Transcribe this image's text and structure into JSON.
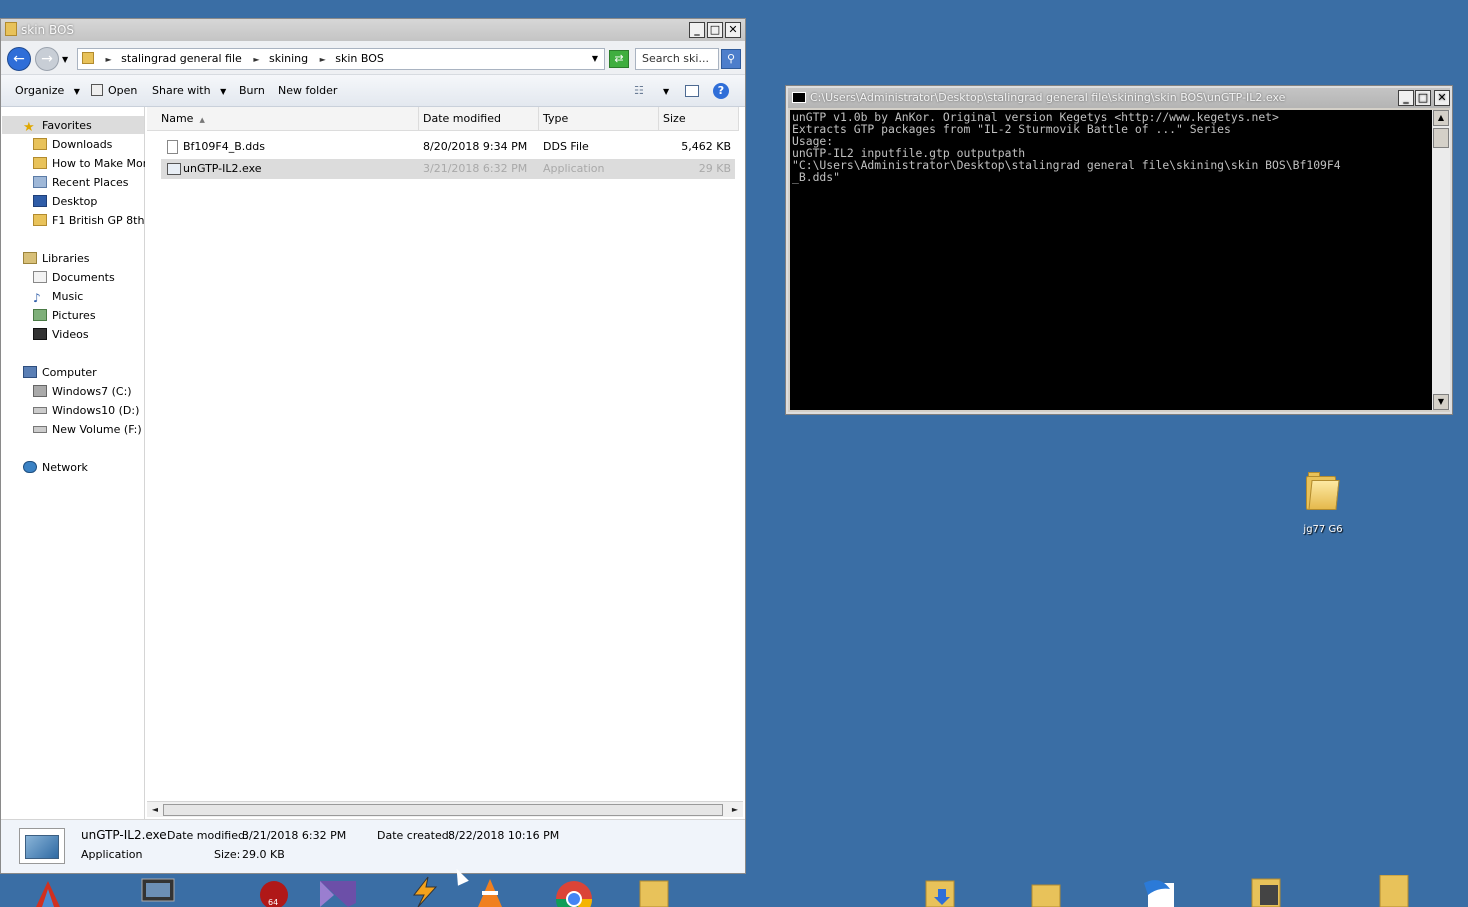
{
  "explorer": {
    "title": "skin BOS",
    "breadcrumb": [
      "stalingrad general file",
      "skining",
      "skin BOS"
    ],
    "search_placeholder": "Search ski...",
    "toolbar": {
      "organize": "Organize",
      "open": "Open",
      "share_with": "Share with",
      "burn": "Burn",
      "new_folder": "New folder"
    },
    "nav": {
      "favorites": "Favorites",
      "favorites_items": [
        "Downloads",
        "How to Make Mone",
        "Recent Places",
        "Desktop",
        "F1 British GP 8th Ju"
      ],
      "libraries": "Libraries",
      "libraries_items": [
        "Documents",
        "Music",
        "Pictures",
        "Videos"
      ],
      "computer": "Computer",
      "computer_items": [
        "Windows7 (C:)",
        "Windows10 (D:)",
        "New Volume (F:)"
      ],
      "network": "Network"
    },
    "columns": [
      "Name",
      "Date modified",
      "Type",
      "Size"
    ],
    "files": [
      {
        "name": "Bf109F4_B.dds",
        "date": "8/20/2018 9:34 PM",
        "type": "DDS File",
        "size": "5,462 KB"
      },
      {
        "name": "unGTP-IL2.exe",
        "date": "3/21/2018 6:32 PM",
        "type": "Application",
        "size": "29 KB"
      }
    ],
    "details": {
      "name": "unGTP-IL2.exe",
      "modified_label": "Date modified:",
      "modified": "3/21/2018 6:32 PM",
      "created_label": "Date created:",
      "created": "8/22/2018 10:16 PM",
      "type": "Application",
      "size_label": "Size:",
      "size": "29.0 KB"
    }
  },
  "console": {
    "title": "C:\\Users\\Administrator\\Desktop\\stalingrad general file\\skining\\skin BOS\\unGTP-IL2.exe",
    "lines": [
      "unGTP v1.0b by AnKor. Original version Kegetys <http://www.kegetys.net>",
      "Extracts GTP packages from \"IL-2 Sturmovik Battle of ...\" Series",
      "Usage:",
      "unGTP-IL2 inputfile.gtp outputpath",
      "\"C:\\Users\\Administrator\\Desktop\\stalingrad general file\\skining\\skin BOS\\Bf109F4",
      "_B.dds\""
    ]
  },
  "desktop": {
    "icon_jg77": "jg77 G6"
  }
}
